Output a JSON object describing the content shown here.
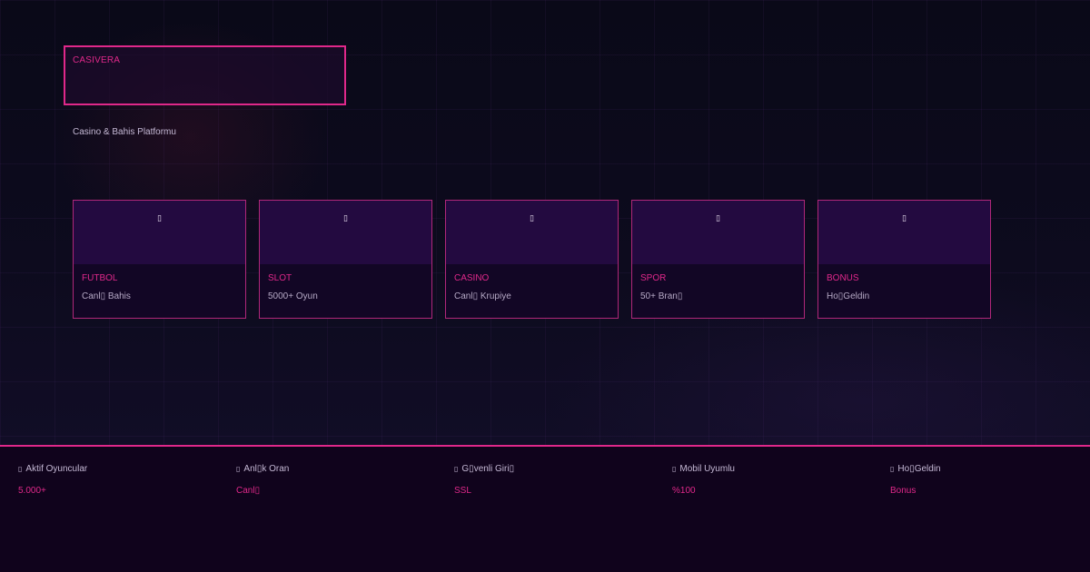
{
  "header": {
    "brand": "CASIVERA",
    "tagline": "Casino & Bahis Platformu"
  },
  "cards": [
    {
      "icon": "football-icon",
      "icon_glyph": "▯",
      "title": "FUTBOL",
      "subtitle": "Canl▯ Bahis"
    },
    {
      "icon": "slot-icon",
      "icon_glyph": "▯",
      "title": "SLOT",
      "subtitle": "5000+ Oyun"
    },
    {
      "icon": "casino-icon",
      "icon_glyph": "▯",
      "title": "CASINO",
      "subtitle": "Canl▯ Krupiye"
    },
    {
      "icon": "sport-icon",
      "icon_glyph": "▯",
      "title": "SPOR",
      "subtitle": "50+ Bran▯"
    },
    {
      "icon": "bonus-icon",
      "icon_glyph": "▯",
      "title": "BONUS",
      "subtitle": "Ho▯Geldin"
    }
  ],
  "footer": {
    "stats": [
      {
        "icon": "players-icon",
        "icon_glyph": "▯",
        "label": "Aktif Oyuncular",
        "value": "5.000+"
      },
      {
        "icon": "odds-icon",
        "icon_glyph": "▯",
        "label": "Anl▯k Oran",
        "value": "Canl▯"
      },
      {
        "icon": "lock-icon",
        "icon_glyph": "▯",
        "label": "G▯venli Giri▯",
        "value": "SSL"
      },
      {
        "icon": "mobile-icon",
        "icon_glyph": "▯",
        "label": "Mobil Uyumlu",
        "value": "%100"
      },
      {
        "icon": "gift-icon",
        "icon_glyph": "▯",
        "label": "Ho▯Geldin",
        "value": "Bonus"
      }
    ]
  },
  "colors": {
    "accent": "#e0288a",
    "background": "#0a0918",
    "card_header": "#230a40",
    "footer_bg": "#10031c"
  }
}
